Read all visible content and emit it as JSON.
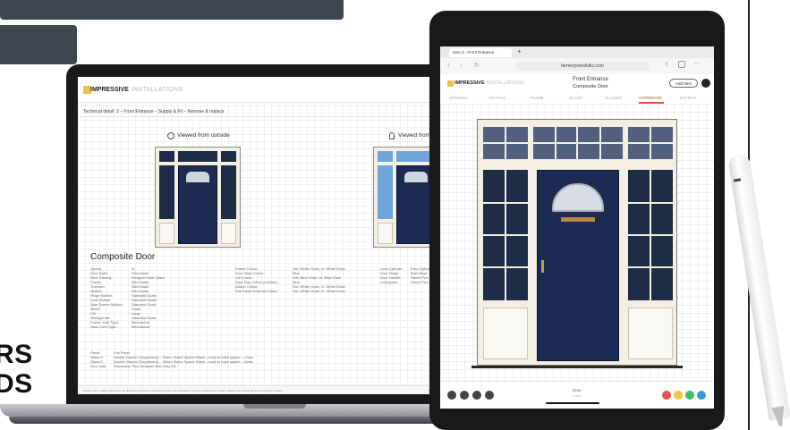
{
  "side_text": {
    "line1": "RS",
    "line2": "DS"
  },
  "laptop": {
    "brand": "IMPRESSIVE",
    "brand_suffix": "INSTALLATIONS",
    "tech_detail": "Technical detail: 3 – Front Entrance – Supply & Fit – Remove & replace",
    "view_outside": "Viewed from outside",
    "view_inside": "Viewed from i",
    "section_title": "Composite Door",
    "spec_labels": [
      "Opens:",
      "Door Style:",
      "Door Glazing:",
      "Frame:",
      "Transom:",
      "Mullion:",
      "Hinge Mullion:",
      "Lock Mullion:",
      "Side Screen Mullion:",
      "Bevel:",
      "Cill:",
      "Astragal bar:",
      "Frame Joint Type:",
      "Sash Joint Type:"
    ],
    "spec_values": [
      "In",
      "Gloucester",
      "Designer Both Glass",
      "Slim Duals",
      "Slim Duals",
      "Slim Duals",
      "Standard Duals",
      "Standard Duals",
      "Standard Duals",
      "Duals",
      "Large",
      "Standard Duals",
      "Mechanical",
      "Mechanical"
    ],
    "colour_labels": [
      "Frame Colour:",
      "Door Style Colour:",
      "Cill Colour:",
      "Door Drip Colour (outside):",
      "Addon Colour:",
      "Flat Panel External Colour:"
    ],
    "colour_values": [
      "Out: White Grain, In: White Grain",
      "Blue",
      "Out: Blue Grain, In: Blue Grain",
      "Blue",
      "Out: White Grain, In: White Grain",
      "Out: White Grain, In: White Grain"
    ],
    "hardware_labels": [
      "Lock Cylinder:",
      "Door Hinge:",
      "Door Handle:",
      "Letterplate:"
    ],
    "hardware_values": [
      "Euro Cylinder",
      "Butt Hinge",
      "Sweet Pea",
      "Sweet Pea"
    ],
    "glass_labels": [
      "Panel:",
      "Glass 1:",
      "Glass 2:",
      "Door side:"
    ],
    "glass_values": [
      "Flat Panel",
      "Double Glazed (Toughened) – 20mm Swiss Spacer Black – back to back spacer – Clear",
      "Double Glazed (Toughened) – 20mm Swiss Spacer Black – back to back spacer – Arctic",
      "Gloucester Plus Designer Bott Grey 1B"
    ],
    "footer_note": "Please note : Images shown are for illustrative purposes. Dimensions given are illustrative. Priority of dimensions remain stated in the official quote for completed orders.",
    "footer_right": "Printed"
  },
  "tablet": {
    "tab_label": "Item 3 - Front Entrance",
    "url": "farmerjonesfolks.com",
    "brand": "IMPRESSIVE",
    "brand_suffix": "INSTALLATIONS",
    "title": "Front Entrance",
    "subtitle": "Composite Door",
    "add_button": "Add Item",
    "tabs": [
      "OPENING",
      "PROFILE",
      "FRAME",
      "GLASS",
      "GLAZING",
      "HARDWARE",
      "EXTRAS"
    ],
    "active_tab": "HARDWARE",
    "bottom_center_1": "Door",
    "bottom_center_2": "1 of 1"
  },
  "colors": {
    "door_blue": "#1d2a52",
    "frame_cream": "#f3efe2",
    "active_tab": "#e0553b",
    "dot_red": "#e5534b",
    "dot_yellow": "#f0c53b",
    "dot_green": "#3bbd6c",
    "dot_blue": "#3a9ad9"
  }
}
